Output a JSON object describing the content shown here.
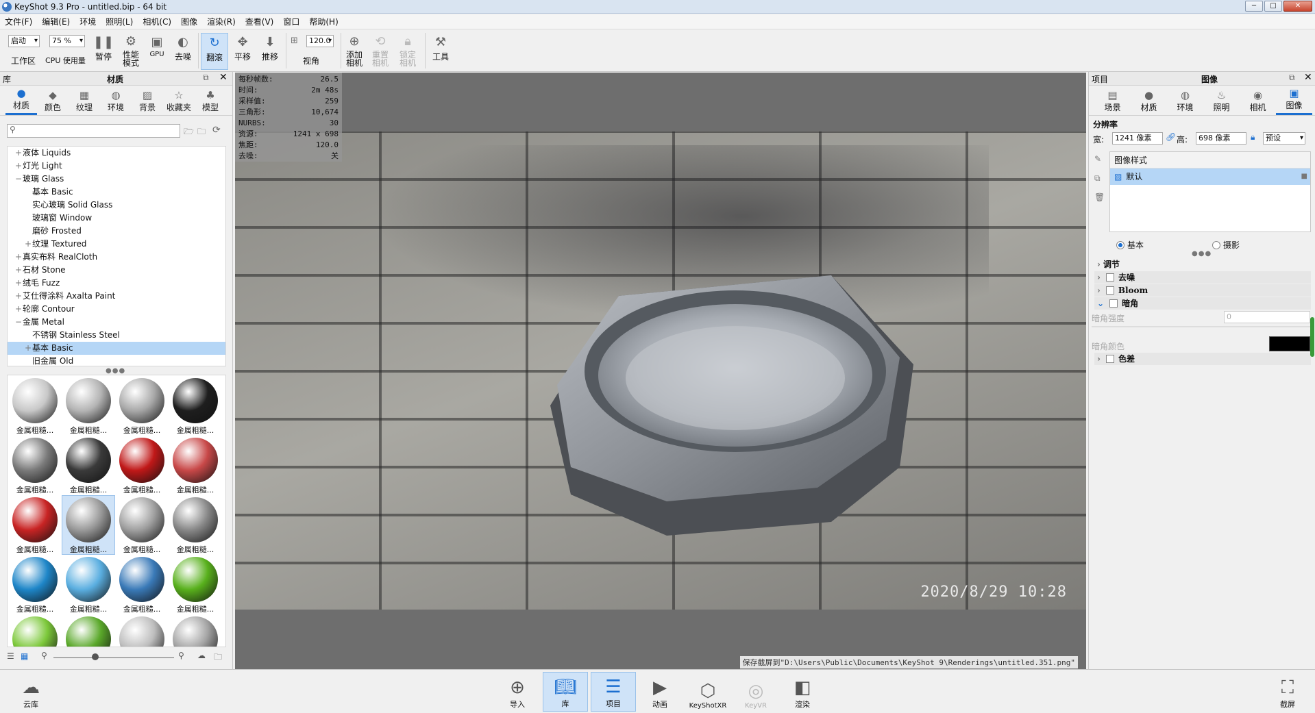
{
  "window": {
    "title": "KeyShot 9.3 Pro  - untitled.bip  - 64 bit",
    "min": "─",
    "max": "□",
    "close": "✕"
  },
  "menu": [
    "文件(F)",
    "编辑(E)",
    "环境",
    "照明(L)",
    "相机(C)",
    "图像",
    "渲染(R)",
    "查看(V)",
    "窗口",
    "帮助(H)"
  ],
  "toolbar": {
    "workspace_value": "启动",
    "workspace_label": "工作区",
    "cpu_value": "75 %",
    "cpu_label": "CPU 使用量",
    "pause": "暂停",
    "perf_mode": "性能\n模式",
    "gpu": "GPU",
    "denoise": "去噪",
    "tumble": "翻滚",
    "pan": "平移",
    "dolly": "推移",
    "fov_value": "120.0",
    "fov_label": "视角",
    "add_camera": "添加\n相机",
    "reset_camera": "重置\n相机",
    "lock_camera": "锁定\n相机",
    "tools": "工具"
  },
  "library": {
    "header_left": "库",
    "header_title": "材质",
    "tabs": [
      "材质",
      "颜色",
      "纹理",
      "环境",
      "背景",
      "收藏夹",
      "模型"
    ],
    "tree": [
      {
        "label": "液体 Liquids",
        "level": 0,
        "exp": "+"
      },
      {
        "label": "灯光 Light",
        "level": 0,
        "exp": "+"
      },
      {
        "label": "玻璃 Glass",
        "level": 0,
        "exp": "−"
      },
      {
        "label": "基本 Basic",
        "level": 1,
        "exp": ""
      },
      {
        "label": "实心玻璃 Solid Glass",
        "level": 1,
        "exp": ""
      },
      {
        "label": "玻璃窗 Window",
        "level": 1,
        "exp": ""
      },
      {
        "label": "磨砂 Frosted",
        "level": 1,
        "exp": ""
      },
      {
        "label": "纹理 Textured",
        "level": 1,
        "exp": "+"
      },
      {
        "label": "真实布料 RealCloth",
        "level": 0,
        "exp": "+"
      },
      {
        "label": "石材 Stone",
        "level": 0,
        "exp": "+"
      },
      {
        "label": "绒毛 Fuzz",
        "level": 0,
        "exp": "+"
      },
      {
        "label": "艾仕得涂料 Axalta Paint",
        "level": 0,
        "exp": "+"
      },
      {
        "label": "轮廓 Contour",
        "level": 0,
        "exp": "+"
      },
      {
        "label": "金属 Metal",
        "level": 0,
        "exp": "−"
      },
      {
        "label": "不锈钢 Stainless Steel",
        "level": 1,
        "exp": ""
      },
      {
        "label": "基本 Basic",
        "level": 1,
        "exp": "+",
        "selected": true
      },
      {
        "label": "旧金属 Old",
        "level": 1,
        "exp": ""
      }
    ],
    "thumb_label": "金属粗糙...",
    "thumb_colors": [
      "#c8c8c8",
      "#b4b4b4",
      "#a8a8a8",
      "#1e1e1e",
      "#7a7a7a",
      "#3a3a3a",
      "#c01818",
      "#c84848",
      "#c82424",
      "#9a9a9a",
      "#a0a0a0",
      "#888888",
      "#1e86c8",
      "#5aaee0",
      "#3a7ab8",
      "#58b01c",
      "#7cc83a",
      "#5aa82a",
      "#bdbdbd",
      "#a4a4a4"
    ]
  },
  "stats": [
    {
      "k": "每秒帧数:",
      "v": "26.5"
    },
    {
      "k": "时间:",
      "v": "2m 48s"
    },
    {
      "k": "采样值:",
      "v": "259"
    },
    {
      "k": "三角形:",
      "v": "10,674"
    },
    {
      "k": "NURBS:",
      "v": "30"
    },
    {
      "k": "资源:",
      "v": "1241 x 698"
    },
    {
      "k": "焦距:",
      "v": "120.0"
    },
    {
      "k": "去噪:",
      "v": "关"
    }
  ],
  "viewport": {
    "stamp": "2020/8/29  10:28",
    "status": "保存截屏到\"D:\\Users\\Public\\Documents\\KeyShot 9\\Renderings\\untitled.351.png\""
  },
  "project": {
    "header_left": "项目",
    "header_title": "图像",
    "tabs": [
      "场景",
      "材质",
      "环境",
      "照明",
      "相机",
      "图像"
    ],
    "resolution_label": "分辨率",
    "width_label": "宽:",
    "width_value": "1241 像素",
    "height_label": "高:",
    "height_value": "698 像素",
    "preset": "预设",
    "style_header": "图像样式",
    "style_default": "默认",
    "mode_basic": "基本",
    "mode_photo": "摄影",
    "adjust_label": "调节",
    "denoise": "去噪",
    "bloom": "Bloom",
    "vignette": "暗角",
    "vignette_strength": "暗角强度",
    "vignette_strength_value": "0",
    "vignette_color": "暗角颜色",
    "vignette_color_hex": "#000000",
    "chromatic": "色差"
  },
  "bottom": [
    {
      "label": "云库",
      "icon": "cloud-library-icon"
    },
    {
      "label": "导入",
      "icon": "import-icon"
    },
    {
      "label": "库",
      "icon": "library-icon",
      "sel": true
    },
    {
      "label": "项目",
      "icon": "project-icon",
      "sel": true
    },
    {
      "label": "动画",
      "icon": "animation-icon"
    },
    {
      "label": "KeyShotXR",
      "icon": "keyshotxr-icon"
    },
    {
      "label": "KeyVR",
      "icon": "keyvr-icon",
      "dim": true
    },
    {
      "label": "渲染",
      "icon": "render-icon"
    },
    {
      "label": "截屏",
      "icon": "screenshot-icon"
    }
  ]
}
